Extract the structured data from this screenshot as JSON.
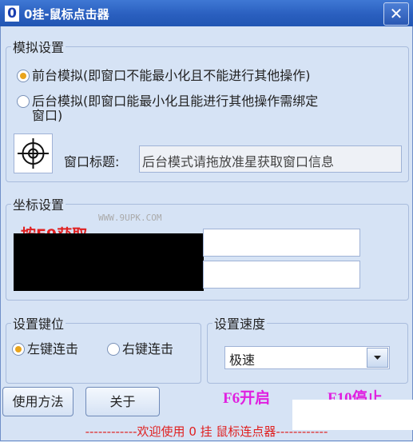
{
  "window": {
    "title": "0挂-鼠标点击器",
    "app_icon_text": "0",
    "close_symbol": "✕"
  },
  "simulation": {
    "legend": "模拟设置",
    "options": [
      {
        "label": "前台模拟(即窗口不能最小化且不能进行其他操作)",
        "selected": true
      },
      {
        "label_line1": "后台模拟(即窗口能最小化且能进行其他操作需绑定",
        "label_line2": "窗口)",
        "selected": false
      }
    ],
    "window_title_label": "窗口标题:",
    "window_title_value": "后台模式请拖放准星获取窗口信息"
  },
  "coords": {
    "legend": "坐标设置",
    "watermark": "WWW.9UPK.COM",
    "partial_text": "按F9获取",
    "x_value": "",
    "y_value": ""
  },
  "mouse_key": {
    "legend": "设置键位",
    "options": [
      {
        "label": "左键连击",
        "selected": true
      },
      {
        "label": "右键连击",
        "selected": false
      }
    ]
  },
  "speed": {
    "legend": "设置速度",
    "selected": "极速"
  },
  "buttons": {
    "usage": "使用方法",
    "about": "关于"
  },
  "hotkeys": {
    "start": "F6开启",
    "stop": "F10停止"
  },
  "footer": "------------欢迎使用 0 挂 鼠标连点器------------",
  "colors": {
    "title_bar": "#2a5fbf",
    "background": "#d6e3f5",
    "accent_radio": "#e9a41d",
    "hotkey_text": "#e020e0",
    "footer_text": "#e02020"
  }
}
